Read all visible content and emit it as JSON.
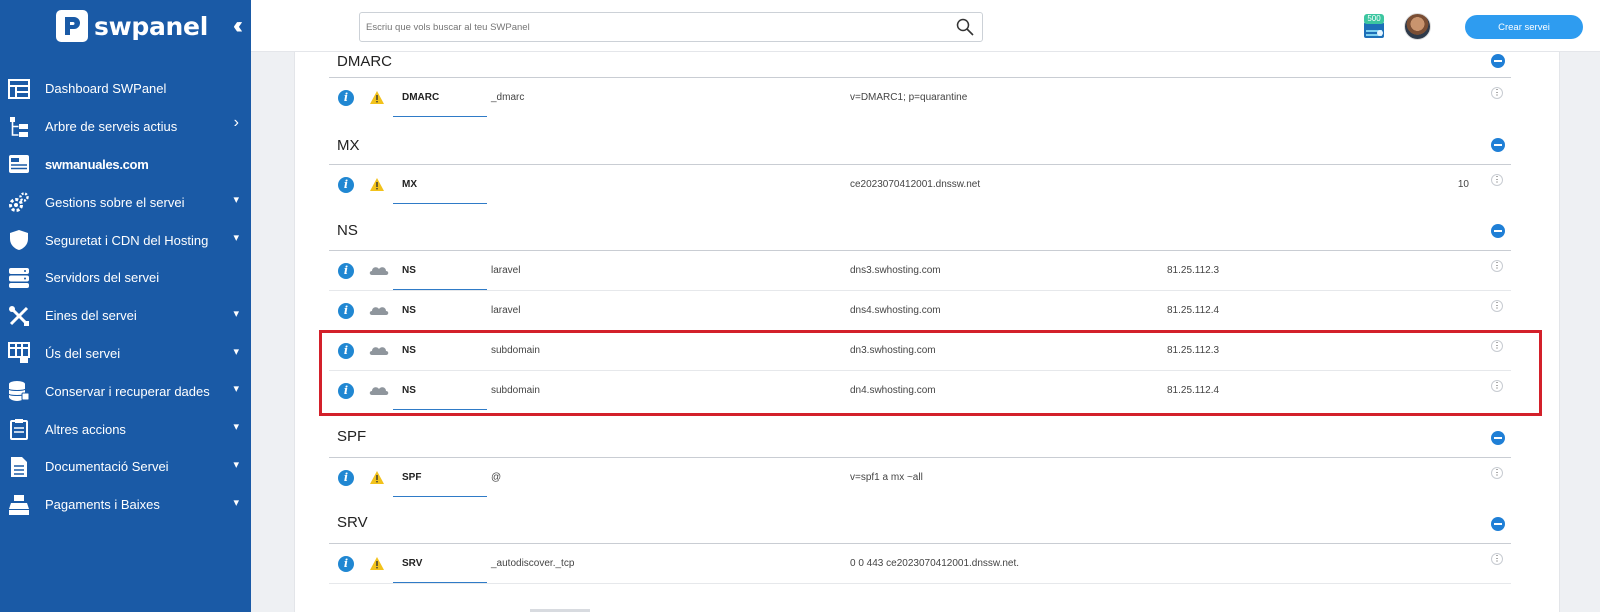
{
  "brand": {
    "name": "swpanel"
  },
  "sidebar": {
    "items": [
      {
        "label": "Dashboard SWPanel",
        "icon": "dashboard-icon",
        "chevron": ""
      },
      {
        "label": "Arbre de serveis actius",
        "icon": "tree-icon",
        "chevron": "›"
      },
      {
        "label": "swmanuales.com",
        "icon": "service-card-icon",
        "chevron": ""
      },
      {
        "label": "Gestions sobre el servei",
        "icon": "gears-icon",
        "chevron": "⌄"
      },
      {
        "label": "Seguretat i CDN del Hosting",
        "icon": "shield-icon",
        "chevron": "⌄"
      },
      {
        "label": "Servidors del servei",
        "icon": "servers-icon",
        "chevron": ""
      },
      {
        "label": "Eines del servei",
        "icon": "tools-icon",
        "chevron": "⌄"
      },
      {
        "label": "Ús del servei",
        "icon": "usage-icon",
        "chevron": "⌄"
      },
      {
        "label": "Conservar i recuperar dades",
        "icon": "database-icon",
        "chevron": "⌄"
      },
      {
        "label": "Altres accions",
        "icon": "clipboard-icon",
        "chevron": "⌄"
      },
      {
        "label": "Documentació Servei",
        "icon": "document-icon",
        "chevron": "⌄"
      },
      {
        "label": "Pagaments i Baixes",
        "icon": "register-icon",
        "chevron": "⌄"
      }
    ]
  },
  "topbar": {
    "search_placeholder": "Escriu que vols buscar al teu SWPanel",
    "badge_value": "500",
    "create_label": "Crear servei"
  },
  "sections": {
    "dmarc": {
      "title": "DMARC"
    },
    "mx": {
      "title": "MX"
    },
    "ns": {
      "title": "NS"
    },
    "spf": {
      "title": "SPF"
    },
    "srv": {
      "title": "SRV"
    }
  },
  "records": {
    "dmarc0": {
      "type": "DMARC",
      "name": "_dmarc",
      "value": "v=DMARC1; p=quarantine",
      "extra": "",
      "prio": ""
    },
    "mx0": {
      "type": "MX",
      "name": "",
      "value": "ce2023070412001.dnssw.net",
      "extra": "",
      "prio": "10"
    },
    "ns0": {
      "type": "NS",
      "name": "laravel",
      "value": "dns3.swhosting.com",
      "extra": "81.25.112.3",
      "prio": ""
    },
    "ns1": {
      "type": "NS",
      "name": "laravel",
      "value": "dns4.swhosting.com",
      "extra": "81.25.112.4",
      "prio": ""
    },
    "ns2": {
      "type": "NS",
      "name": "subdomain",
      "value": "dn3.swhosting.com",
      "extra": "81.25.112.3",
      "prio": ""
    },
    "ns3": {
      "type": "NS",
      "name": "subdomain",
      "value": "dn4.swhosting.com",
      "extra": "81.25.112.4",
      "prio": ""
    },
    "spf0": {
      "type": "SPF",
      "name": "@",
      "value": "v=spf1 a mx ~all",
      "extra": "",
      "prio": ""
    },
    "srv0": {
      "type": "SRV",
      "name": "_autodiscover._tcp",
      "value": "0 0 443 ce2023070412001.dnssw.net.",
      "extra": "",
      "prio": ""
    }
  },
  "colors": {
    "sidebar_bg": "#1a5aa6",
    "accent": "#2e9cf0",
    "info_blue": "#2087d2",
    "warning": "#f2c21b",
    "highlight": "#d3202a"
  }
}
